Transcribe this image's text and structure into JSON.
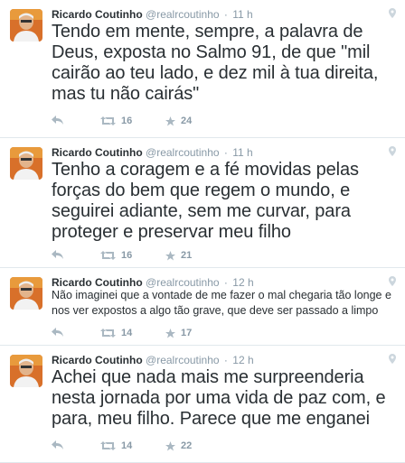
{
  "tweets": [
    {
      "name": "Ricardo Coutinho",
      "handle": "@realrcoutinho",
      "time": "11 h",
      "text": "Tendo em mente, sempre, a palavra de Deus, exposta no Salmo 91, de que \"mil cairão ao teu lado, e dez mil à tua direita, mas tu não cairás\"",
      "retweets": "16",
      "favorites": "24"
    },
    {
      "name": "Ricardo Coutinho",
      "handle": "@realrcoutinho",
      "time": "11 h",
      "text": "Tenho a coragem e a fé movidas pelas forças do bem que regem o mundo, e seguirei adiante, sem me curvar, para proteger e preservar meu filho",
      "retweets": "16",
      "favorites": "21"
    },
    {
      "name": "Ricardo Coutinho",
      "handle": "@realrcoutinho",
      "time": "12 h",
      "text": "Não imaginei que a vontade de me fazer o mal chegaria tão longe e nos ver expostos a algo tão grave, que deve ser passado a limpo",
      "retweets": "14",
      "favorites": "17"
    },
    {
      "name": "Ricardo Coutinho",
      "handle": "@realrcoutinho",
      "time": "12 h",
      "text": "Achei que nada mais me surpreenderia nesta jornada por uma vida de paz com, e para, meu filho. Parece que me enganei",
      "retweets": "14",
      "favorites": "22"
    }
  ],
  "icons": {
    "reply": "reply-icon",
    "retweet": "retweet-icon",
    "favorite": "star-icon",
    "location": "location-pin-icon"
  },
  "colors": {
    "text": "#292f33",
    "muted": "#8899a6",
    "icon": "#aab8c2",
    "divider": "#e1e8ed"
  }
}
